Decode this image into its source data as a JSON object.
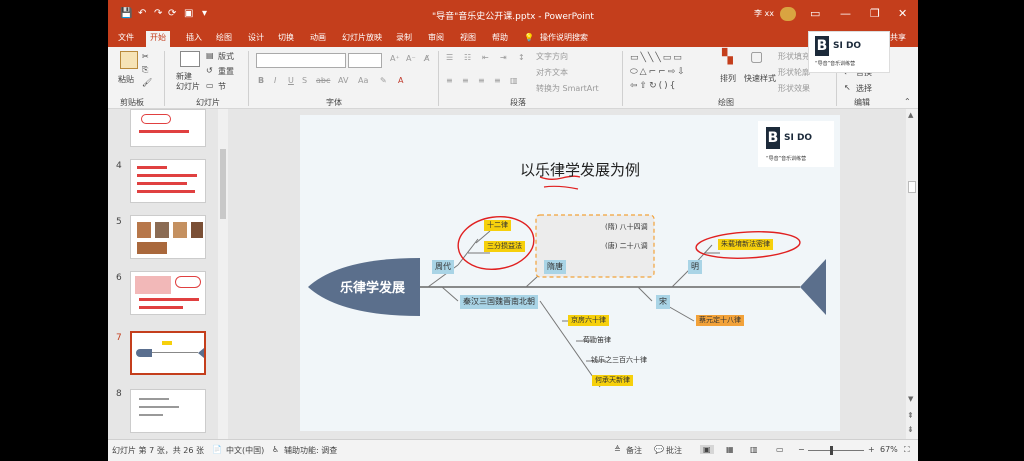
{
  "window": {
    "title": "\"导音\"音乐史公开课.pptx - PowerPoint",
    "user": "李 xx"
  },
  "tabs": [
    "文件",
    "开始",
    "插入",
    "绘图",
    "设计",
    "切换",
    "动画",
    "幻灯片放映",
    "录制",
    "审阅",
    "视图",
    "帮助",
    "操作说明搜索",
    "共享"
  ],
  "active_tab": "开始",
  "ribbon": {
    "paste": "粘贴",
    "new_slide": "新建\n幻灯片",
    "layout": "版式",
    "reset": "重置",
    "section": "节",
    "text_direction": "文字方向",
    "align_text": "对齐文本",
    "smartart": "转换为 SmartArt",
    "arrange": "排列",
    "quick_styles": "快速样式",
    "fill": "形状填充",
    "outline": "形状轮廓",
    "effects": "形状效果",
    "find": "查找",
    "replace": "替换",
    "select": "选择",
    "groups": [
      "剪贴板",
      "幻灯片",
      "字体",
      "段落",
      "绘图",
      "编辑"
    ]
  },
  "logo": {
    "letter": "B",
    "brand": "SI DO",
    "tagline": "“导音”音乐训练营"
  },
  "thumbnails": [
    "4",
    "5",
    "6",
    "7",
    "8"
  ],
  "selected_thumbnail": "7",
  "slide": {
    "title": "以乐律学发展为例",
    "head": "乐律学发展",
    "top_dynasties": [
      "周代",
      "隋唐",
      "明"
    ],
    "bottom_dynasties": [
      "秦汉三国魏晋南北朝",
      "宋"
    ],
    "zhou_items": [
      "十二律",
      "三分损益法"
    ],
    "suitang_items": [
      "(隋) 八十四调",
      "(唐) 二十八调"
    ],
    "ming_items": [
      "朱载堉新法密律"
    ],
    "qinhan_items": [
      "京房六十律",
      "荀勖笛律",
      "钱乐之三百六十律",
      "何承天新律"
    ],
    "song_items": [
      "蔡元定十八律"
    ]
  },
  "status": {
    "slide_info": "幻灯片 第 7 张，共 26 张",
    "language": "中文(中国)",
    "accessibility": "辅助功能: 调查",
    "notes": "备注",
    "comments": "批注",
    "zoom": "67%"
  }
}
